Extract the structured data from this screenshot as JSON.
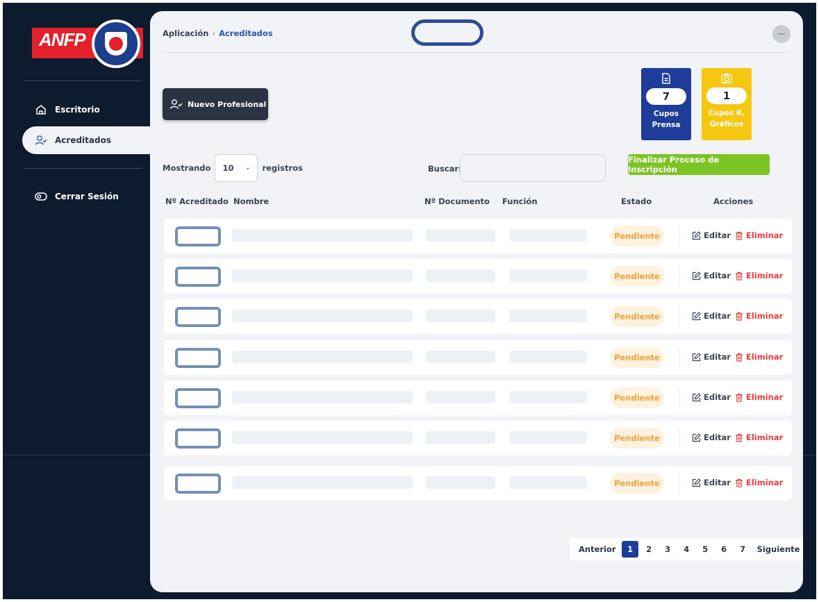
{
  "sidebar": {
    "logo_text": "ANFP",
    "items": [
      {
        "label": "Escritorio",
        "icon": "home-icon"
      },
      {
        "label": "Acreditados",
        "icon": "user-check-icon"
      },
      {
        "label": "Cerrar Sesión",
        "icon": "toggle-icon"
      }
    ]
  },
  "breadcrumb": {
    "root": "Aplicación",
    "current": "Acreditados"
  },
  "actions": {
    "new_label": "Nuevo Profesional",
    "finalize_label": "Finalizar Proceso de Inscripción"
  },
  "quotas": [
    {
      "value": "7",
      "line1": "Cupos",
      "line2": "Prensa",
      "color": "#1e3d9a",
      "icon": "document-icon"
    },
    {
      "value": "1",
      "line1": "Cupos R.",
      "line2": "Gráficos",
      "color": "#f6c710",
      "icon": "camera-icon"
    }
  ],
  "table_controls": {
    "show_prefix": "Mostrando",
    "page_size": "10",
    "show_suffix": "registros",
    "search_label": "Buscar:"
  },
  "table": {
    "headers": [
      "Nº Acreditado",
      "Nombre",
      "Nº Documento",
      "Función",
      "Estado",
      "Acciones"
    ],
    "rows": [
      {
        "status": "Pendiente",
        "edit": "Editar",
        "delete": "Eliminar"
      },
      {
        "status": "Pendiente",
        "edit": "Editar",
        "delete": "Eliminar"
      },
      {
        "status": "Pendiente",
        "edit": "Editar",
        "delete": "Eliminar"
      },
      {
        "status": "Pendiente",
        "edit": "Editar",
        "delete": "Eliminar"
      },
      {
        "status": "Pendiente",
        "edit": "Editar",
        "delete": "Eliminar"
      },
      {
        "status": "Pendiente",
        "edit": "Editar",
        "delete": "Eliminar"
      },
      {
        "status": "Pendiente",
        "edit": "Editar",
        "delete": "Eliminar"
      }
    ]
  },
  "pagination": {
    "prev": "Anterior",
    "next": "Siguiente",
    "pages": [
      "1",
      "2",
      "3",
      "4",
      "5",
      "6",
      "7"
    ],
    "current": "1"
  },
  "colors": {
    "sidebar_bg": "#0d1b2e",
    "accent": "#1e3d9a",
    "success": "#7cc424",
    "warning": "#f6c710",
    "danger": "#e23b3b"
  }
}
